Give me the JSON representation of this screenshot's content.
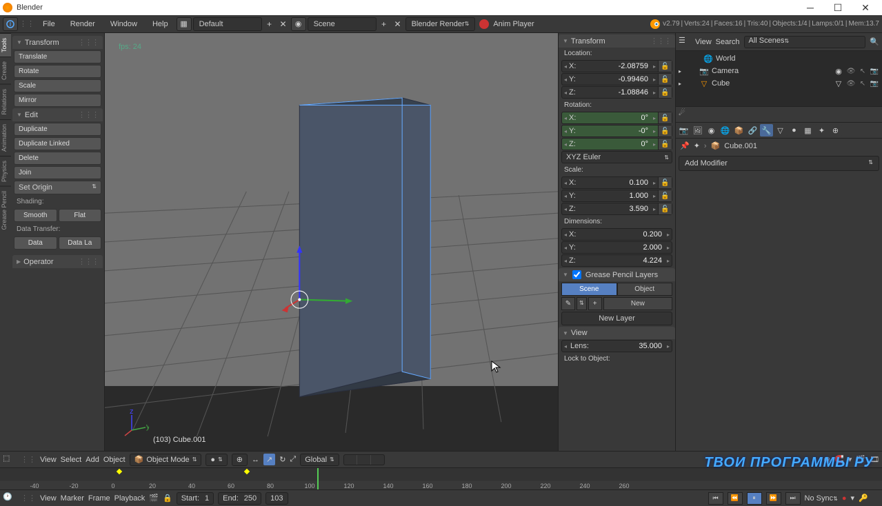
{
  "title": "Blender",
  "menubar": {
    "file": "File",
    "render": "Render",
    "window": "Window",
    "help": "Help",
    "layout": "Default",
    "scene": "Scene",
    "engine": "Blender Render",
    "anim": "Anim Player"
  },
  "info": {
    "version": "v2.79",
    "verts": "Verts:24",
    "faces": "Faces:16",
    "tris": "Tris:40",
    "objects": "Objects:1/4",
    "lamps": "Lamps:0/1",
    "mem": "Mem:13.7"
  },
  "sidetabs": [
    "Tools",
    "Create",
    "Relations",
    "Animation",
    "Physics",
    "Grease Pencil"
  ],
  "tools": {
    "transform_hdr": "Transform",
    "translate": "Translate",
    "rotate": "Rotate",
    "scale": "Scale",
    "mirror": "Mirror",
    "edit_hdr": "Edit",
    "duplicate": "Duplicate",
    "dup_linked": "Duplicate Linked",
    "delete": "Delete",
    "join": "Join",
    "set_origin": "Set Origin",
    "shading_lbl": "Shading:",
    "smooth": "Smooth",
    "flat": "Flat",
    "datat_lbl": "Data Transfer:",
    "data": "Data",
    "datala": "Data La",
    "operator_hdr": "Operator"
  },
  "viewport": {
    "fps": "fps: 24",
    "objname": "(103) Cube.001"
  },
  "npanel": {
    "transform_hdr": "Transform",
    "loc_lbl": "Location:",
    "loc": {
      "x": "-2.08759",
      "y": "-0.99460",
      "z": "-1.08846"
    },
    "rot_lbl": "Rotation:",
    "rot": {
      "x": "0°",
      "y": "-0°",
      "z": "0°"
    },
    "rot_mode": "XYZ Euler",
    "scale_lbl": "Scale:",
    "scl": {
      "x": "0.100",
      "y": "1.000",
      "z": "3.590"
    },
    "dim_lbl": "Dimensions:",
    "dim": {
      "x": "0.200",
      "y": "2.000",
      "z": "4.224"
    },
    "gp_hdr": "Grease Pencil Layers",
    "scene_btn": "Scene",
    "object_btn": "Object",
    "new_btn": "New",
    "newlayer_btn": "New Layer",
    "view_hdr": "View",
    "lens_lbl": "Lens:",
    "lens_val": "35.000",
    "lock_lbl": "Lock to Object:"
  },
  "vpheader": {
    "view": "View",
    "select": "Select",
    "add": "Add",
    "object": "Object",
    "mode": "Object Mode",
    "orient": "Global"
  },
  "outliner": {
    "view": "View",
    "search": "Search",
    "filter": "All Scenes",
    "items": [
      {
        "name": "World",
        "icon": "world"
      },
      {
        "name": "Camera",
        "icon": "camera"
      },
      {
        "name": "Cube",
        "icon": "mesh"
      }
    ]
  },
  "props": {
    "obj": "Cube.001",
    "add_mod": "Add Modifier"
  },
  "timeline": {
    "ticks": [
      "-40",
      "-20",
      "0",
      "20",
      "40",
      "60",
      "80",
      "100",
      "120",
      "140",
      "160",
      "180",
      "200",
      "220",
      "240",
      "260"
    ],
    "view": "View",
    "marker": "Marker",
    "frame": "Frame",
    "playback": "Playback",
    "start_lbl": "Start:",
    "start": "1",
    "end_lbl": "End:",
    "end": "250",
    "cur": "103",
    "sync": "No Sync"
  },
  "watermark": "ТВОИ ПРОГРАММЫ РУ"
}
